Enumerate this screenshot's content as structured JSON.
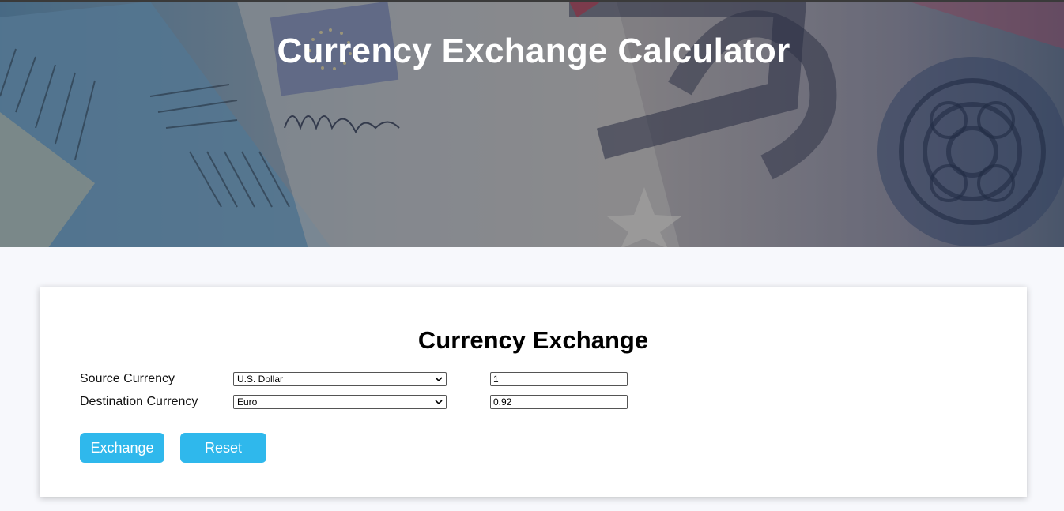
{
  "header": {
    "title": "Currency Exchange Calculator"
  },
  "card": {
    "title": "Currency Exchange",
    "source": {
      "label": "Source Currency",
      "selected_currency": "U.S. Dollar",
      "amount": "1"
    },
    "destination": {
      "label": "Destination Currency",
      "selected_currency": "Euro",
      "amount": "0.92"
    },
    "buttons": {
      "exchange_label": "Exchange",
      "reset_label": "Reset"
    }
  },
  "colors": {
    "button_bg": "#2fb8ec",
    "page_bg": "#f7f8fc",
    "card_bg": "#ffffff"
  },
  "icons": {
    "dropdown": "chevron-down-icon"
  }
}
